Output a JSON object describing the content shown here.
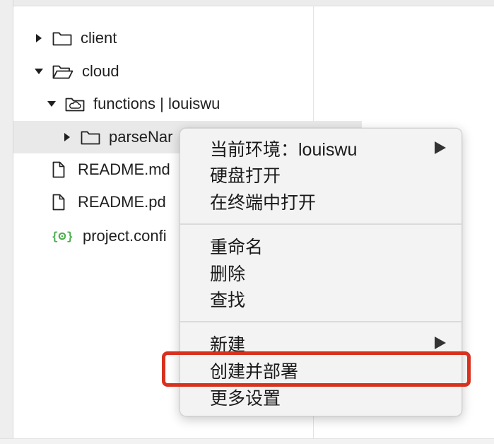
{
  "tree": {
    "items": [
      {
        "label": "client",
        "icon": "folder-icon"
      },
      {
        "label": "cloud",
        "icon": "folder-open-icon"
      },
      {
        "label": "functions | louiswu",
        "icon": "cloud-folder-icon"
      },
      {
        "label": "parseNar",
        "icon": "folder-icon"
      },
      {
        "label": "README.md",
        "icon": "file-icon"
      },
      {
        "label": "README.pd",
        "icon": "file-icon"
      },
      {
        "label": "project.confi",
        "icon": "json-config-icon"
      }
    ]
  },
  "context_menu": {
    "items": [
      {
        "label": "当前环境：louiswu",
        "has_submenu": true
      },
      {
        "label": "硬盘打开"
      },
      {
        "label": "在终端中打开"
      },
      {
        "label": "重命名"
      },
      {
        "label": "删除"
      },
      {
        "label": "查找"
      },
      {
        "label": "新建",
        "has_submenu": true
      },
      {
        "label": "创建并部署",
        "highlighted": true
      },
      {
        "label": "更多设置"
      }
    ]
  },
  "colors": {
    "highlight_border": "#d8311e",
    "config_icon": "#4caf50",
    "selected_row": "#e9e9e9"
  }
}
